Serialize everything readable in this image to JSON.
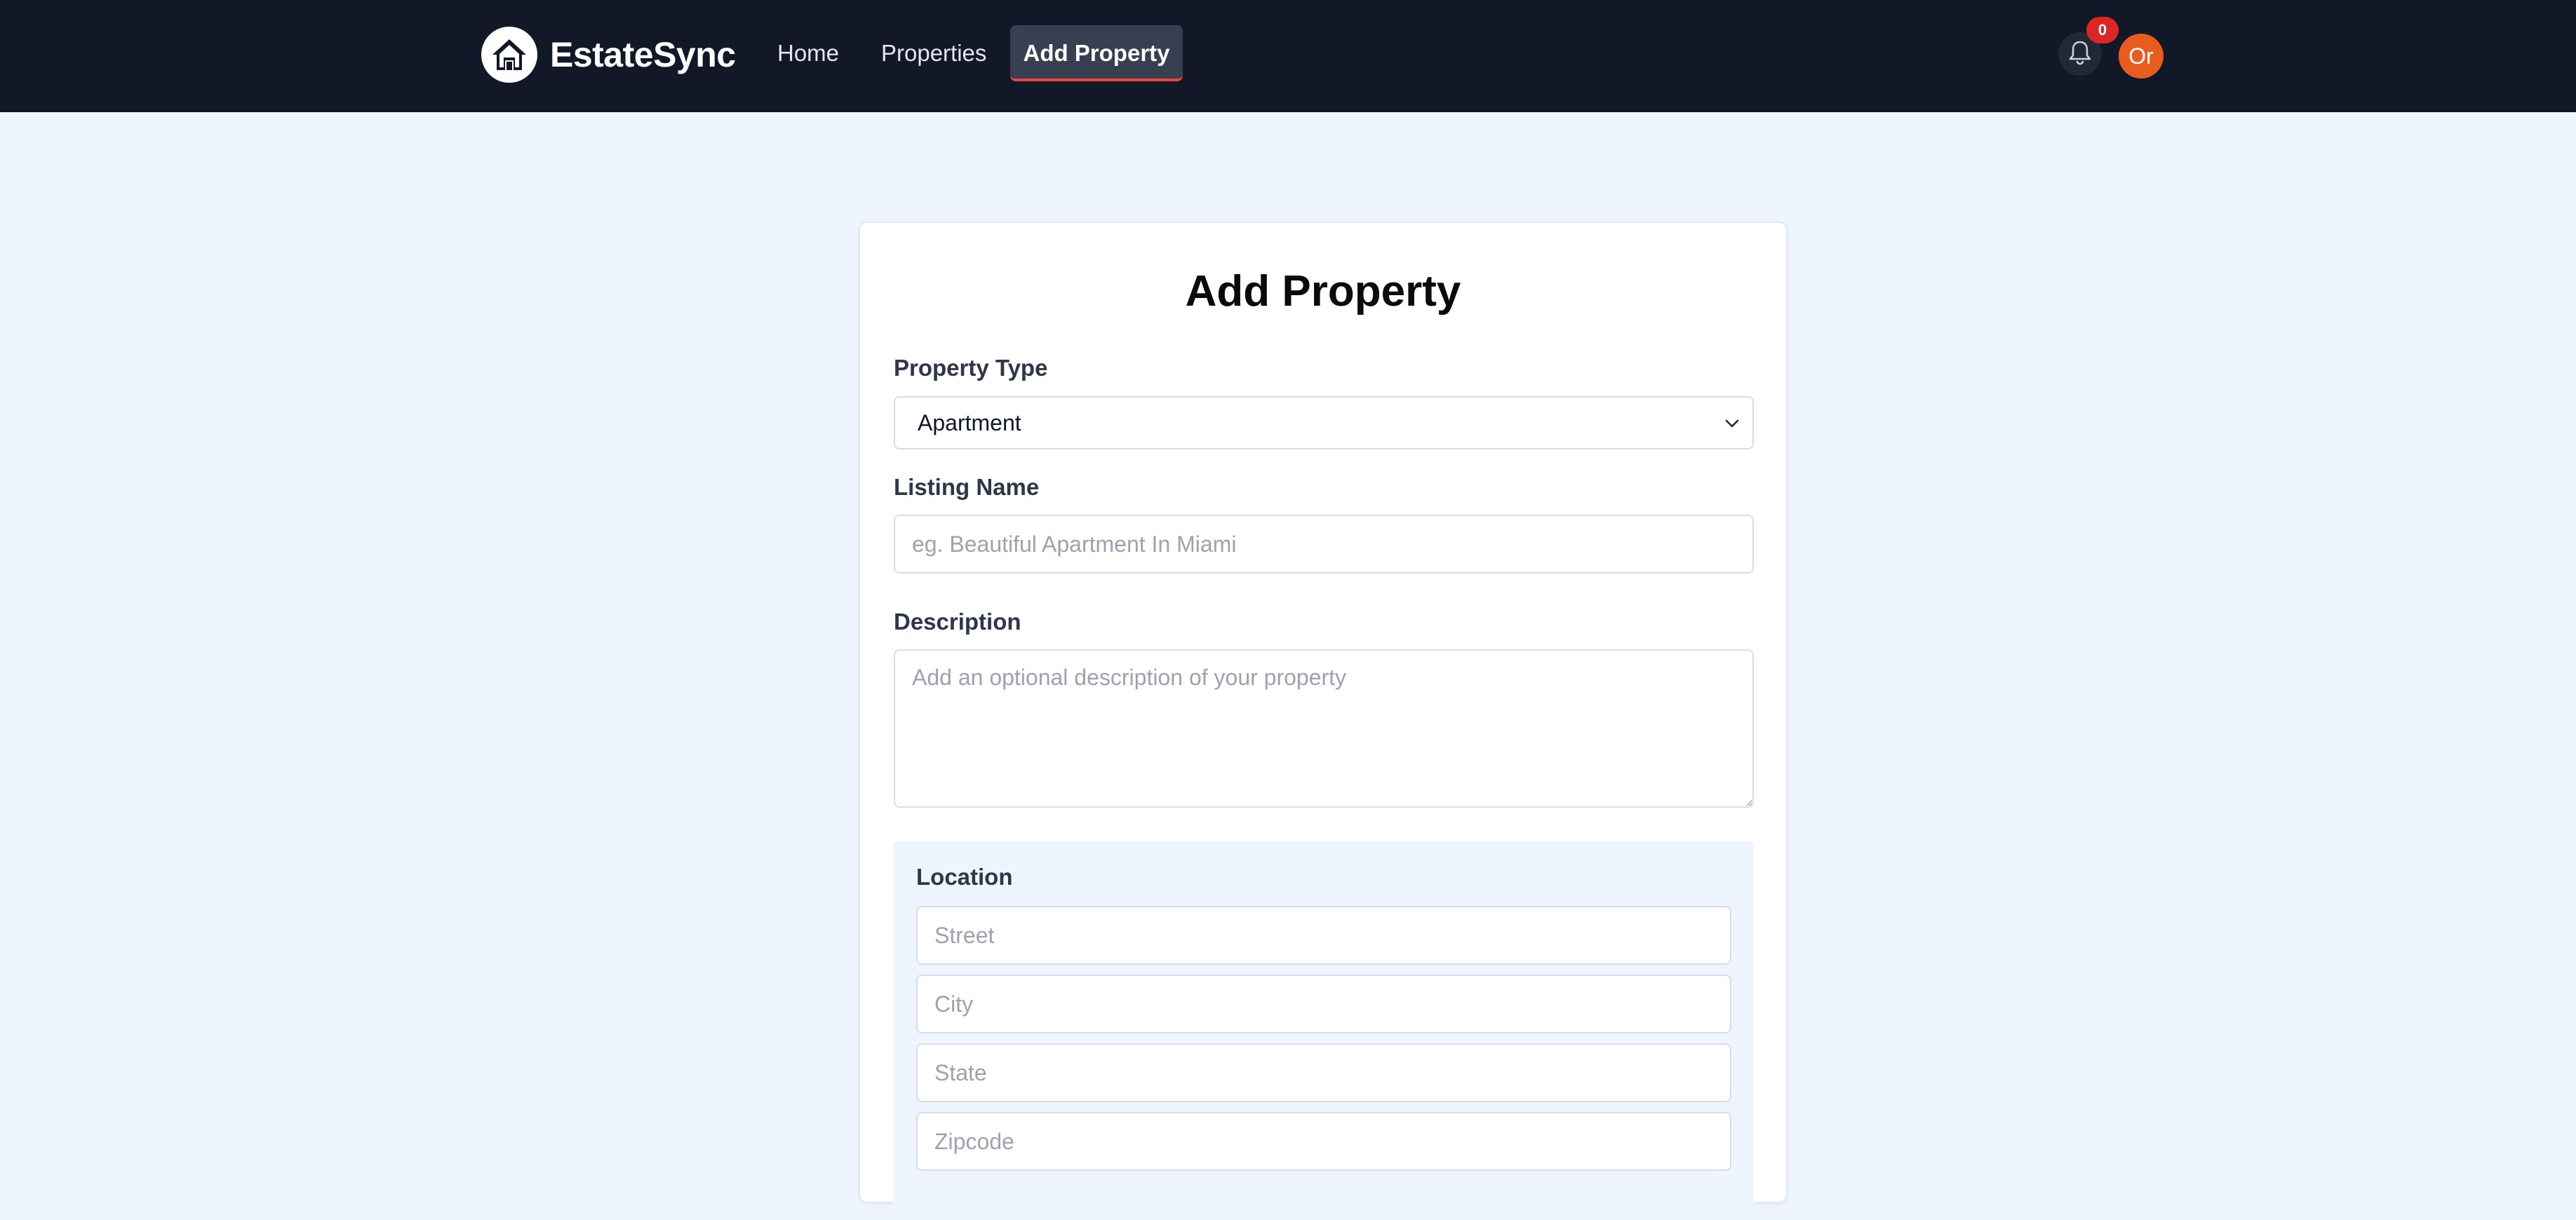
{
  "navbar": {
    "brand_name": "EstateSync",
    "links": [
      {
        "label": "Home"
      },
      {
        "label": "Properties"
      },
      {
        "label": "Add Property"
      }
    ],
    "notification_count": "0",
    "avatar_initials": "Or"
  },
  "form": {
    "title": "Add Property",
    "property_type": {
      "label": "Property Type",
      "selected": "Apartment"
    },
    "listing_name": {
      "label": "Listing Name",
      "placeholder": "eg. Beautiful Apartment In Miami",
      "value": ""
    },
    "description": {
      "label": "Description",
      "placeholder": "Add an optional description of your property",
      "value": ""
    },
    "location": {
      "label": "Location",
      "street_placeholder": "Street",
      "city_placeholder": "City",
      "state_placeholder": "State",
      "zipcode_placeholder": "Zipcode"
    }
  },
  "colors": {
    "navbar_bg": "#121827",
    "page_bg": "#eef5fe",
    "active_tab_bg": "#374051",
    "active_tab_underline": "#ef4444",
    "badge": "#dc2626",
    "avatar": "#e85d1e"
  },
  "icons": {
    "brand": "house-icon",
    "notifications": "bell-icon",
    "select": "chevron-down-icon",
    "textarea": "resize-grip-icon"
  }
}
